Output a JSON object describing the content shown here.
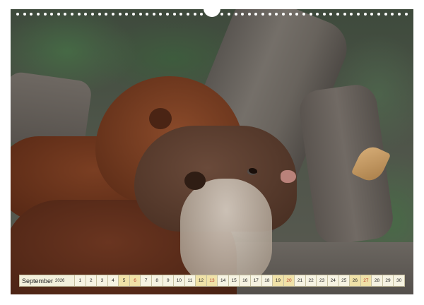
{
  "calendar": {
    "month": "September",
    "year": "2026",
    "days": [
      {
        "label": "1",
        "kind": "weekday"
      },
      {
        "label": "2",
        "kind": "weekday"
      },
      {
        "label": "3",
        "kind": "weekday"
      },
      {
        "label": "4",
        "kind": "weekday"
      },
      {
        "label": "5",
        "kind": "sat"
      },
      {
        "label": "6",
        "kind": "sun"
      },
      {
        "label": "7",
        "kind": "weekday"
      },
      {
        "label": "8",
        "kind": "weekday"
      },
      {
        "label": "9",
        "kind": "weekday"
      },
      {
        "label": "10",
        "kind": "weekday"
      },
      {
        "label": "11",
        "kind": "weekday"
      },
      {
        "label": "12",
        "kind": "sat"
      },
      {
        "label": "13",
        "kind": "sun"
      },
      {
        "label": "14",
        "kind": "weekday"
      },
      {
        "label": "15",
        "kind": "weekday"
      },
      {
        "label": "16",
        "kind": "weekday"
      },
      {
        "label": "17",
        "kind": "weekday"
      },
      {
        "label": "18",
        "kind": "weekday"
      },
      {
        "label": "19",
        "kind": "sat"
      },
      {
        "label": "20",
        "kind": "sun"
      },
      {
        "label": "21",
        "kind": "weekday"
      },
      {
        "label": "22",
        "kind": "weekday"
      },
      {
        "label": "23",
        "kind": "weekday"
      },
      {
        "label": "24",
        "kind": "weekday"
      },
      {
        "label": "25",
        "kind": "weekday"
      },
      {
        "label": "26",
        "kind": "sat"
      },
      {
        "label": "27",
        "kind": "sun"
      },
      {
        "label": "28",
        "kind": "weekday"
      },
      {
        "label": "29",
        "kind": "weekday"
      },
      {
        "label": "30",
        "kind": "weekday"
      }
    ]
  },
  "photo": {
    "subject": "otters"
  },
  "colors": {
    "strip_bg": "#f3f0dc",
    "weekend_bg": "#f0e2a8",
    "sunday_text": "#b43a2a"
  }
}
